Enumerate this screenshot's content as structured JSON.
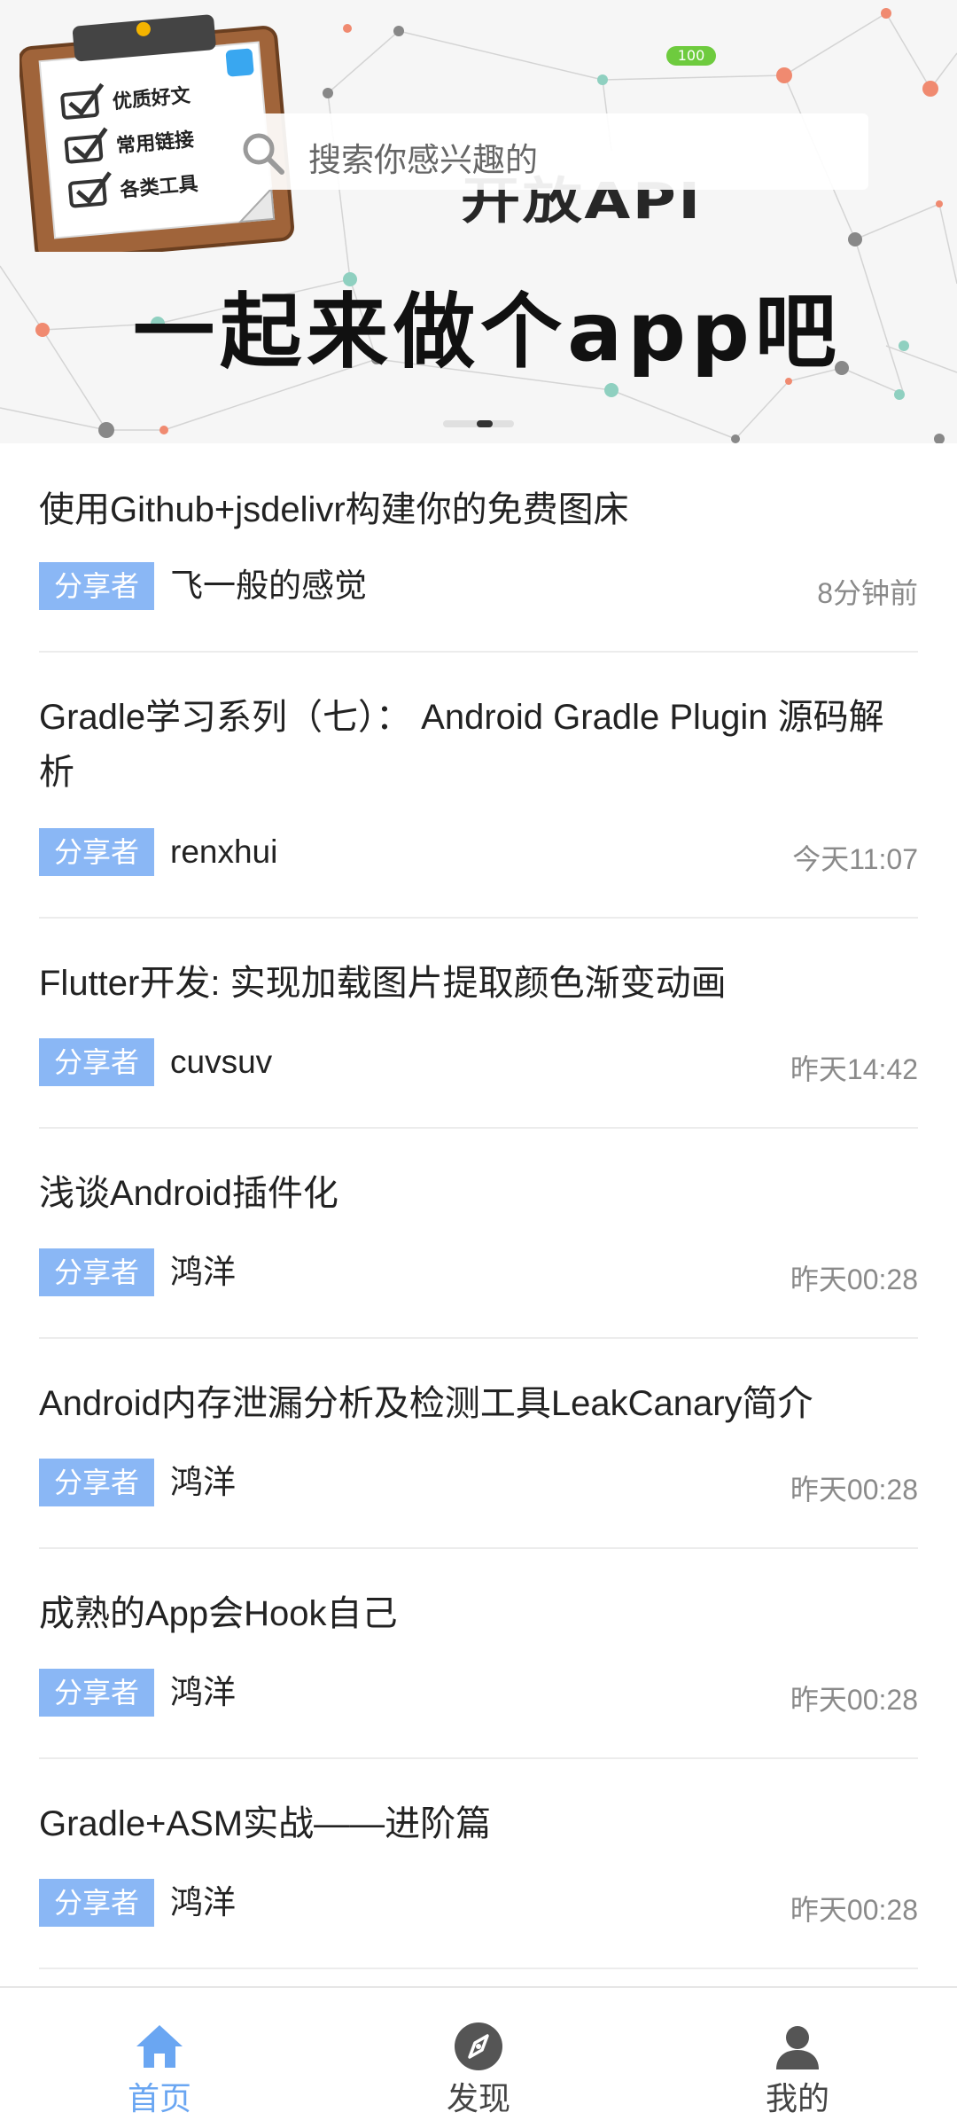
{
  "banner": {
    "title_top": "开放API",
    "title": "一起来做个app吧",
    "battery": "100",
    "clipboard_lines": [
      "优质好文",
      "常用链接",
      "各类工具"
    ]
  },
  "search": {
    "placeholder": "搜索你感兴趣的"
  },
  "articles": [
    {
      "title": "使用Github+jsdelivr构建你的免费图床",
      "tag": "分享者",
      "author": "飞一般的感觉",
      "time": "8分钟前"
    },
    {
      "title": "Gradle学习系列（七）： Android Gradle Plugin 源码解析",
      "tag": "分享者",
      "author": "renxhui",
      "time": "今天11:07"
    },
    {
      "title": "Flutter开发: 实现加载图片提取颜色渐变动画",
      "tag": "分享者",
      "author": "cuvsuv",
      "time": "昨天14:42"
    },
    {
      "title": "浅谈Android插件化",
      "tag": "分享者",
      "author": "鸿洋",
      "time": "昨天00:28"
    },
    {
      "title": "Android内存泄漏分析及检测工具LeakCanary简介",
      "tag": "分享者",
      "author": "鸿洋",
      "time": "昨天00:28"
    },
    {
      "title": "成熟的App会Hook自己",
      "tag": "分享者",
      "author": "鸿洋",
      "time": "昨天00:28"
    },
    {
      "title": "Gradle+ASM实战——进阶篇",
      "tag": "分享者",
      "author": "鸿洋",
      "time": "昨天00:28"
    }
  ],
  "nav": {
    "home": {
      "label": "首页",
      "icon": "home-icon"
    },
    "discover": {
      "label": "发现",
      "icon": "compass-icon"
    },
    "mine": {
      "label": "我的",
      "icon": "user-icon"
    }
  },
  "colors": {
    "accent": "#6aa6f2",
    "tag_bg": "#8ab7f5",
    "time_text": "#8a8a8a",
    "nav_inactive": "#444444"
  }
}
